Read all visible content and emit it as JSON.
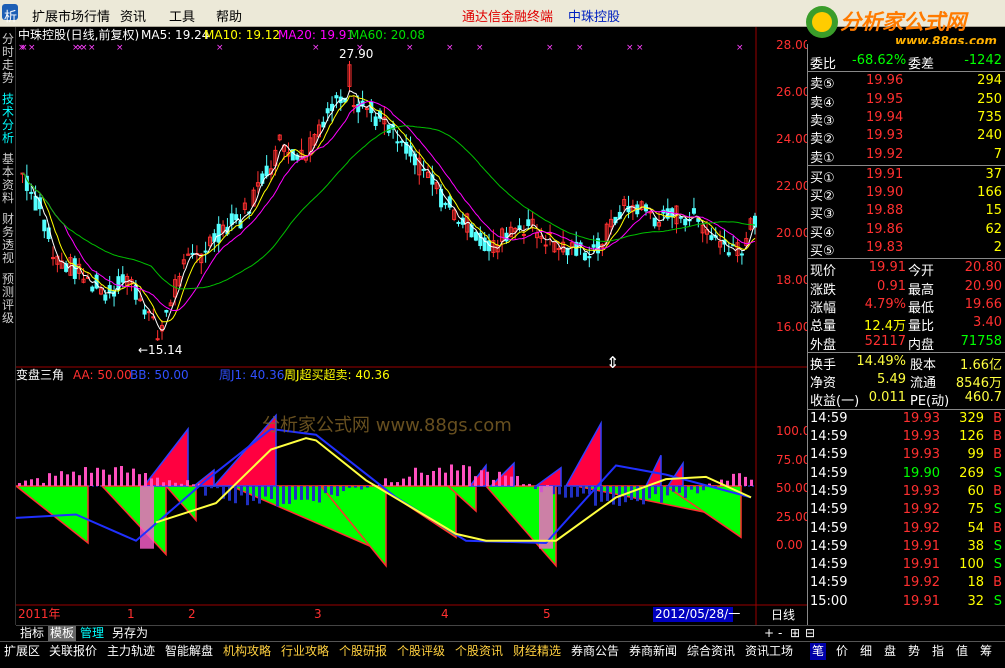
{
  "menubar": {
    "items": [
      "析",
      "扩展市场行情",
      "资讯",
      "工具",
      "帮助"
    ],
    "brand1": "通达信金融终端",
    "brand2": "中珠控股",
    "logo_text": "分析家公式网",
    "logo_url": "www.88gs.com"
  },
  "left_tabs": [
    "分时走势",
    "技术分析",
    "基本资料",
    "财务透视",
    "预测评级"
  ],
  "main_chart": {
    "title": "中珠控股(日线,前复权)",
    "ma5": "MA5: 19.24",
    "ma10": "MA10: 19.12",
    "ma20": "MA20: 19.91",
    "ma60": "MA60: 20.08",
    "high_label": "27.90",
    "low_label": "←15.14",
    "y_ticks": [
      "26.00",
      "24.00",
      "22.00",
      "20.00",
      "18.00",
      "16.00"
    ],
    "top_tick": "28.00"
  },
  "indicator": {
    "title": "变盘三角",
    "aa": "AA: 50.00",
    "bb": "BB: 50.00",
    "zj": "周J1: 40.36",
    "cb": "周J超买超卖: 40.36",
    "y_ticks": [
      "100.0",
      "75.00",
      "50.00",
      "25.00",
      "0.00"
    ],
    "watermark": "分析家公式网 www.88gs.com"
  },
  "x_axis": {
    "year": "2011年",
    "months": [
      "1",
      "2",
      "3",
      "4",
      "5"
    ],
    "date_badge": "2012/05/28/一",
    "period": "日线"
  },
  "quote": {
    "weibi_label": "委比",
    "weibi": "-68.62%",
    "weicha_label": "委差",
    "weicha": "-1242",
    "sell": [
      {
        "label": "卖⑤",
        "price": "19.96",
        "vol": "294"
      },
      {
        "label": "卖④",
        "price": "19.95",
        "vol": "250"
      },
      {
        "label": "卖③",
        "price": "19.94",
        "vol": "735"
      },
      {
        "label": "卖②",
        "price": "19.93",
        "vol": "240"
      },
      {
        "label": "卖①",
        "price": "19.92",
        "vol": "7"
      }
    ],
    "buy": [
      {
        "label": "买①",
        "price": "19.91",
        "vol": "37"
      },
      {
        "label": "买②",
        "price": "19.90",
        "vol": "166"
      },
      {
        "label": "买③",
        "price": "19.88",
        "vol": "15"
      },
      {
        "label": "买④",
        "price": "19.86",
        "vol": "62"
      },
      {
        "label": "买⑤",
        "price": "19.83",
        "vol": "2"
      }
    ],
    "stats": [
      {
        "l1": "现价",
        "v1": "19.91",
        "c1": "#ff3030",
        "l2": "今开",
        "v2": "20.80",
        "c2": "#ff3030"
      },
      {
        "l1": "涨跌",
        "v1": "0.91",
        "c1": "#ff3030",
        "l2": "最高",
        "v2": "20.90",
        "c2": "#ff3030"
      },
      {
        "l1": "涨幅",
        "v1": "4.79%",
        "c1": "#ff3030",
        "l2": "最低",
        "v2": "19.66",
        "c2": "#ff3030"
      },
      {
        "l1": "总量",
        "v1": "12.4万",
        "c1": "#ffff00",
        "l2": "量比",
        "v2": "3.40",
        "c2": "#ff3030"
      },
      {
        "l1": "外盘",
        "v1": "52117",
        "c1": "#ff3030",
        "l2": "内盘",
        "v2": "71758",
        "c2": "#00ff00"
      }
    ],
    "stats2": [
      {
        "l1": "换手",
        "v1": "14.49%",
        "l2": "股本",
        "v2": "1.66亿"
      },
      {
        "l1": "净资",
        "v1": "5.49",
        "l2": "流通",
        "v2": "8546万"
      },
      {
        "l1": "收益(一)",
        "v1": "0.011",
        "l2": "PE(动)",
        "v2": "460.7"
      }
    ],
    "ticks": [
      {
        "t": "14:59",
        "p": "19.93",
        "v": "329",
        "d": "B"
      },
      {
        "t": "14:59",
        "p": "19.93",
        "v": "126",
        "d": "B"
      },
      {
        "t": "14:59",
        "p": "19.93",
        "v": "99",
        "d": "B"
      },
      {
        "t": "14:59",
        "p": "19.90",
        "v": "269",
        "d": "S"
      },
      {
        "t": "14:59",
        "p": "19.93",
        "v": "60",
        "d": "B"
      },
      {
        "t": "14:59",
        "p": "19.92",
        "v": "75",
        "d": "S"
      },
      {
        "t": "14:59",
        "p": "19.92",
        "v": "54",
        "d": "B"
      },
      {
        "t": "14:59",
        "p": "19.91",
        "v": "38",
        "d": "S"
      },
      {
        "t": "14:59",
        "p": "19.91",
        "v": "100",
        "d": "S"
      },
      {
        "t": "14:59",
        "p": "19.92",
        "v": "18",
        "d": "B"
      },
      {
        "t": "15:00",
        "p": "19.91",
        "v": "32",
        "d": "S"
      }
    ]
  },
  "tabbar": [
    "指标",
    "模板",
    "管理",
    "另存为"
  ],
  "tabbar_right": [
    "+",
    "-",
    "⊞",
    "⊟",
    "▭"
  ],
  "statusbar": [
    "扩展区",
    "关联报价",
    "主力轨迹",
    "智能解盘",
    "机构攻略",
    "行业攻略",
    "个股研报",
    "个股评级",
    "个股资讯",
    "财经精选",
    "券商公告",
    "券商新闻",
    "综合资讯",
    "资讯工场"
  ],
  "statusbar_right": [
    "笔",
    "价",
    "细",
    "盘",
    "势",
    "指",
    "值",
    "筹"
  ],
  "colors": {
    "up": "#ff3030",
    "down": "#00ffff",
    "ma5": "#ffffff",
    "ma10": "#ffff00",
    "ma20": "#ff00ff",
    "ma60": "#00c000"
  }
}
